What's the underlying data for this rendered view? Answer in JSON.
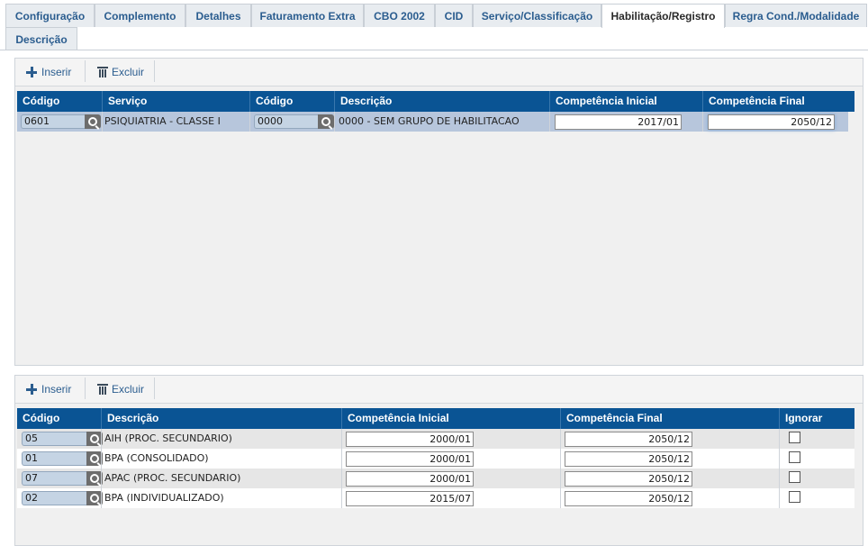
{
  "tabs": [
    "Configuração",
    "Complemento",
    "Detalhes",
    "Faturamento Extra",
    "CBO 2002",
    "CID",
    "Serviço/Classificação",
    "Habilitação/Registro",
    "Regra Cond./Modalidade",
    "Descrição"
  ],
  "active_tab": "Habilitação/Registro",
  "toolbar": {
    "insert_label": "Inserir",
    "delete_label": "Excluir"
  },
  "grid1": {
    "columns": [
      "Código",
      "Serviço",
      "Código",
      "Descrição",
      "Competência Inicial",
      "Competência Final"
    ],
    "rows": [
      {
        "service_code": "0601",
        "service": "PSIQUIATRIA - CLASSE I",
        "code": "0000",
        "description": "0000 - SEM GRUPO DE HABILITACAO",
        "start": "2017/01",
        "end": "2050/12"
      }
    ]
  },
  "grid2": {
    "columns": [
      "Código",
      "Descrição",
      "Competência Inicial",
      "Competência Final",
      "Ignorar"
    ],
    "rows": [
      {
        "code": "05",
        "description": "AIH (PROC. SECUNDARIO)",
        "start": "2000/01",
        "end": "2050/12",
        "ignore": false
      },
      {
        "code": "01",
        "description": "BPA (CONSOLIDADO)",
        "start": "2000/01",
        "end": "2050/12",
        "ignore": false
      },
      {
        "code": "07",
        "description": "APAC (PROC. SECUNDARIO)",
        "start": "2000/01",
        "end": "2050/12",
        "ignore": false
      },
      {
        "code": "02",
        "description": "BPA (INDIVIDUALIZADO)",
        "start": "2015/07",
        "end": "2050/12",
        "ignore": false
      }
    ]
  },
  "colors": {
    "header_bg": "#0a5494",
    "tab_text": "#2b5d8f",
    "selected_row": "#b7c6dc"
  },
  "icons": {
    "insert": "plus-icon",
    "delete": "trash-icon",
    "lookup": "search-icon"
  }
}
